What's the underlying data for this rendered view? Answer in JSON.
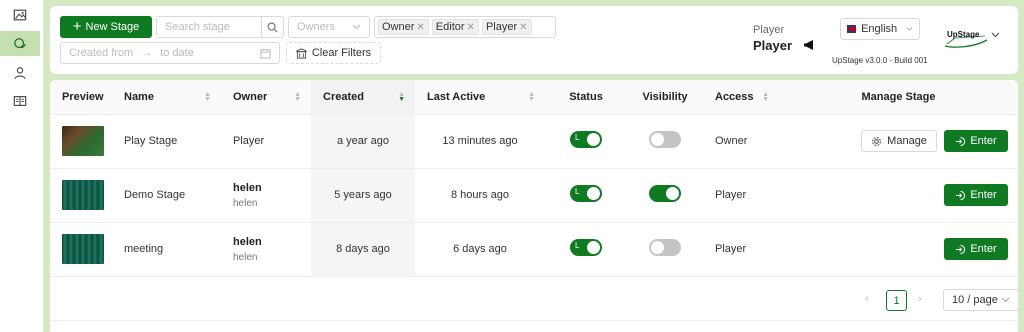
{
  "sidebar": {
    "items": [
      {
        "icon": "image-icon"
      },
      {
        "icon": "chat-icon",
        "active": true
      },
      {
        "icon": "user-icon"
      },
      {
        "icon": "book-icon"
      }
    ]
  },
  "toolbar": {
    "new_stage_label": "New Stage",
    "search_placeholder": "Search stage",
    "owners_placeholder": "Owners",
    "role_tags": [
      "Owner",
      "Editor",
      "Player"
    ],
    "date_from_placeholder": "Created from",
    "date_to_placeholder": "to date",
    "clear_filters_label": "Clear Filters"
  },
  "header": {
    "role_label": "Player",
    "user_name": "Player",
    "language": "English",
    "version": "UpStage v3.0.0 - Build 001",
    "logo_text": "UpStage"
  },
  "table": {
    "columns": [
      "Preview",
      "Name",
      "Owner",
      "Created",
      "Last Active",
      "Status",
      "Visibility",
      "Access",
      "Manage Stage"
    ],
    "rows": [
      {
        "name": "Play Stage",
        "owner": "Player",
        "owner_sub": "",
        "created": "a year ago",
        "last_active": "13 minutes ago",
        "status": "on",
        "visibility": "off",
        "access": "Owner",
        "manage": "Manage",
        "enter": "Enter",
        "thumb": "play"
      },
      {
        "name": "Demo Stage",
        "owner": "helen",
        "owner_sub": "helen",
        "created": "5 years ago",
        "last_active": "8 hours ago",
        "status": "on",
        "visibility": "on",
        "access": "Player",
        "enter": "Enter",
        "thumb": "curtain"
      },
      {
        "name": "meeting",
        "owner": "helen",
        "owner_sub": "helen",
        "created": "8 days ago",
        "last_active": "6 days ago",
        "status": "on",
        "visibility": "off",
        "access": "Player",
        "enter": "Enter",
        "thumb": "curtain"
      }
    ],
    "status_on_label": "L"
  },
  "pagination": {
    "current_page": "1",
    "page_size": "10 / page"
  },
  "colors": {
    "accent": "#0f7a22",
    "background": "#d4e9c4"
  }
}
